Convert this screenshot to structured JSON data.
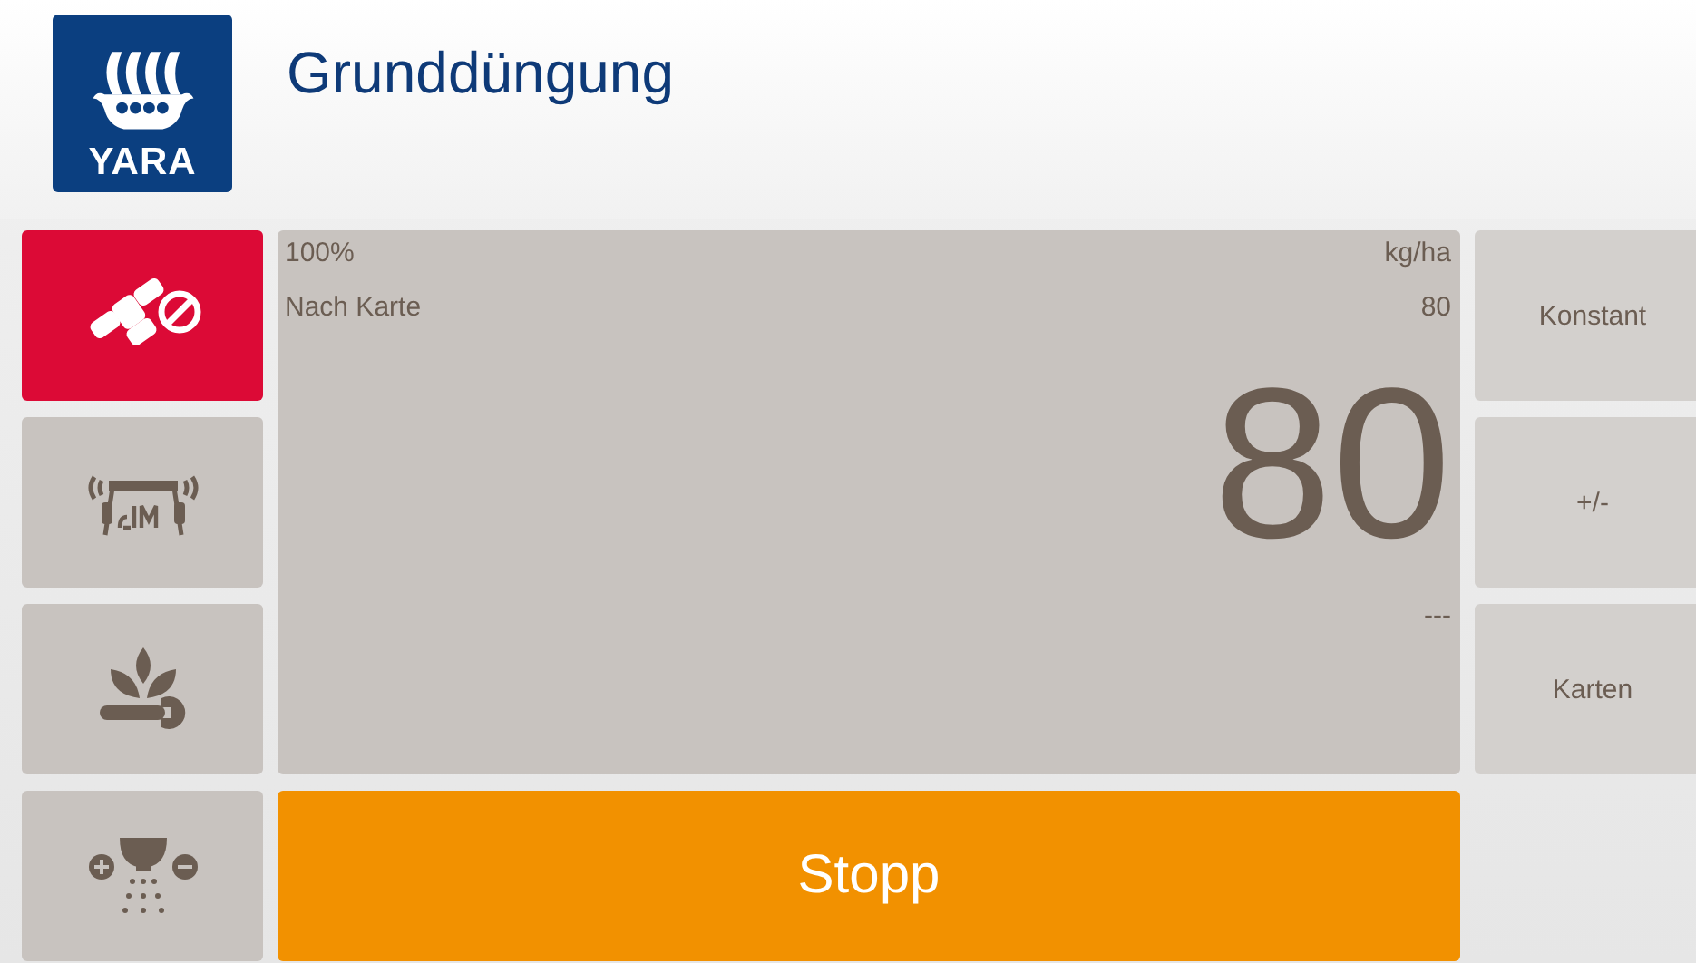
{
  "header": {
    "logo_text": "YARA",
    "title": "Grunddüngung"
  },
  "side_buttons": [
    {
      "kind": "satellite",
      "active": true
    },
    {
      "kind": "simulation",
      "active": false
    },
    {
      "kind": "crop-settings",
      "active": false
    },
    {
      "kind": "spreader",
      "active": false
    }
  ],
  "rate_panel": {
    "percent": "100%",
    "unit": "kg/ha",
    "mode": "Nach Karte",
    "target": "80",
    "value": "80",
    "status": "---"
  },
  "stop_button": {
    "label": "Stopp"
  },
  "mode_buttons": [
    {
      "label": "Konstant"
    },
    {
      "label": "+/-"
    },
    {
      "label": "Karten"
    }
  ]
}
